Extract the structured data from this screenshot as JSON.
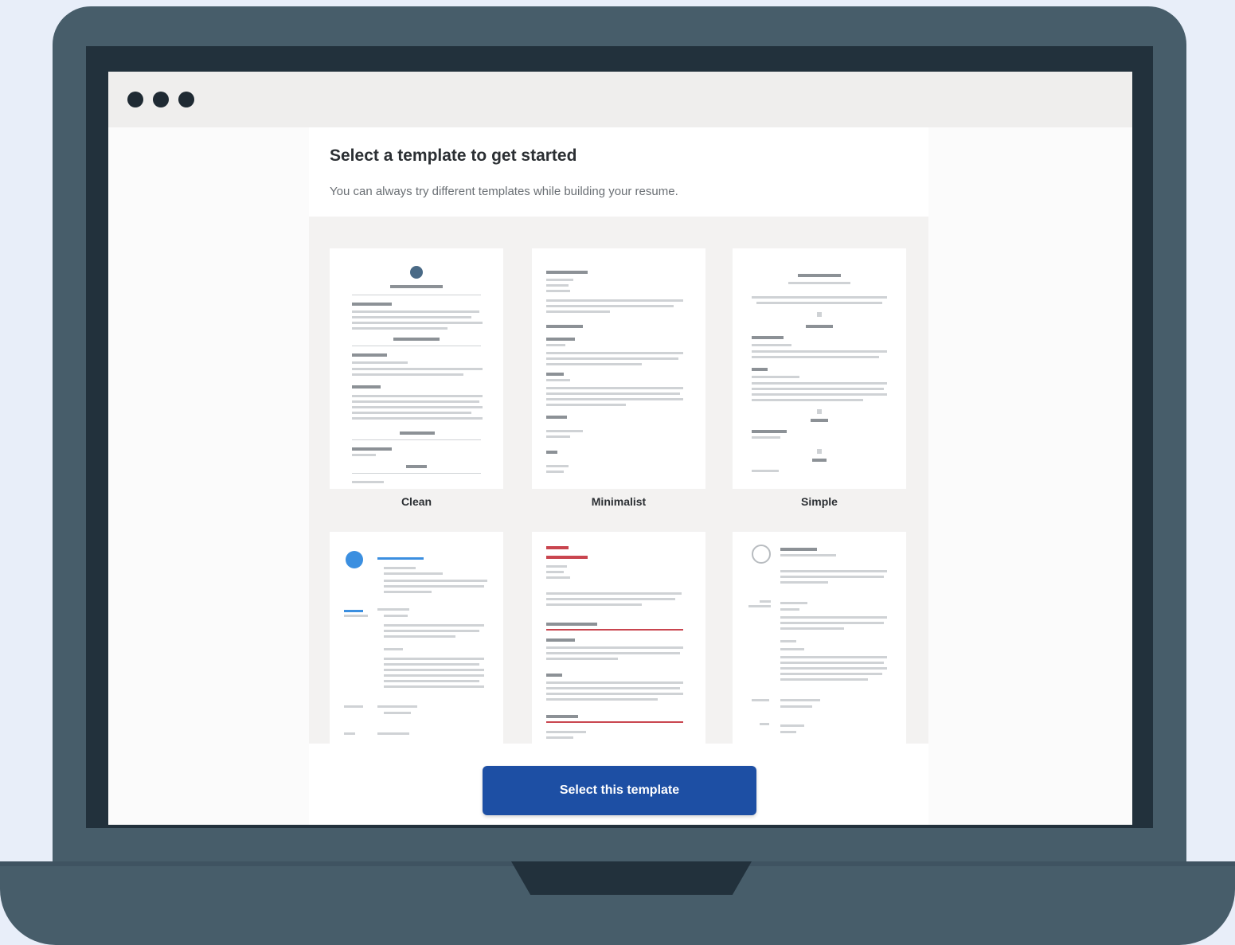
{
  "browser": {
    "window_dots": [
      "dot-1",
      "dot-2",
      "dot-3"
    ]
  },
  "panel": {
    "title": "Select a template to get started",
    "subtitle": "You can always try different templates while building your resume."
  },
  "templates": [
    {
      "name": "Clean"
    },
    {
      "name": "Minimalist"
    },
    {
      "name": "Simple"
    },
    {
      "name": ""
    },
    {
      "name": ""
    },
    {
      "name": ""
    }
  ],
  "footer": {
    "select_button_label": "Select this template"
  },
  "colors": {
    "page_background": "#e8eef9",
    "laptop_body": "#475d6a",
    "bezel": "#22313c",
    "primary_button": "#1d4fa4",
    "accent_red": "#c9454f",
    "accent_blue": "#3b8fe0"
  }
}
